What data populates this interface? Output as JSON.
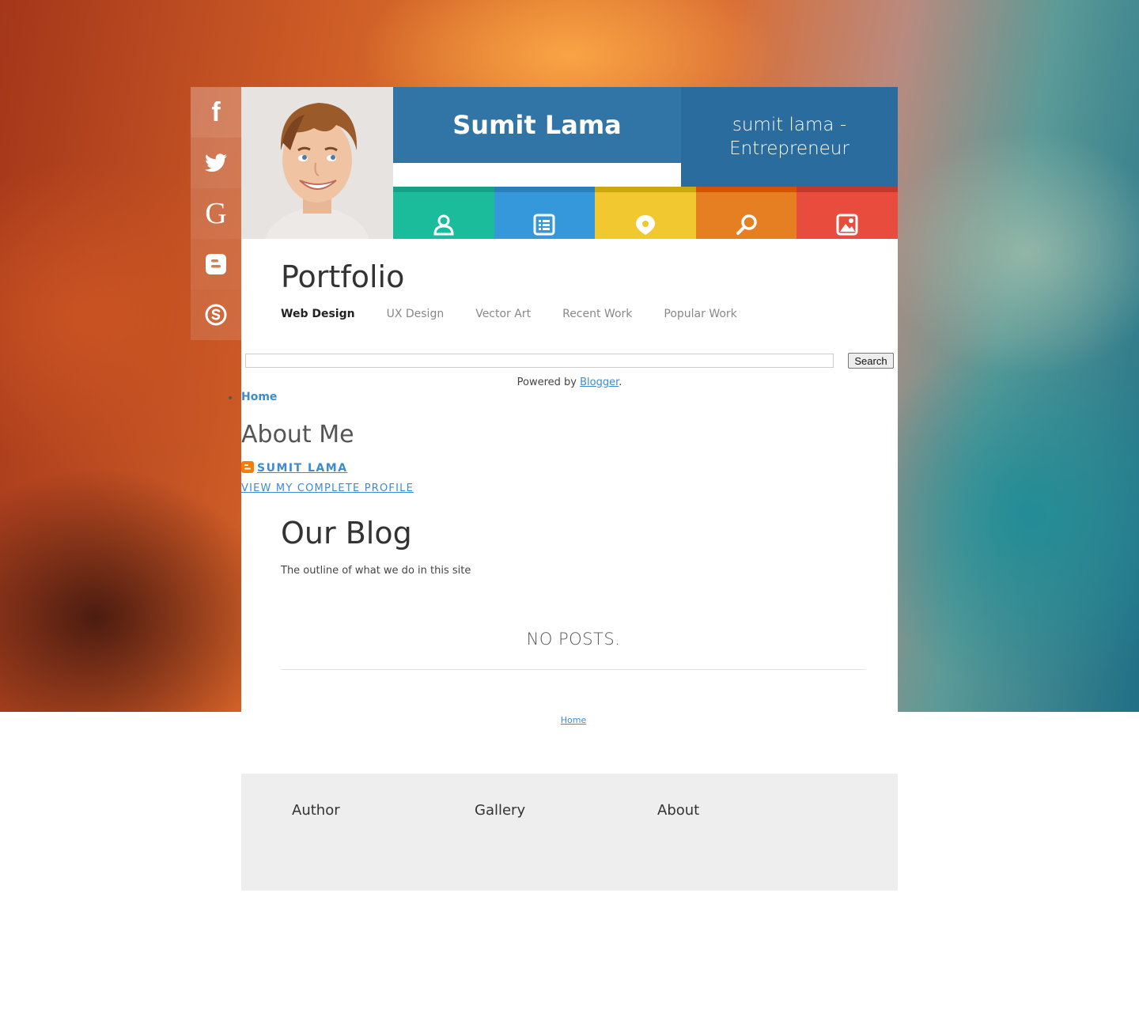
{
  "social": {
    "items": [
      {
        "name": "facebook",
        "glyph": "f"
      },
      {
        "name": "twitter",
        "glyph": ""
      },
      {
        "name": "google",
        "glyph": "G"
      },
      {
        "name": "blogger",
        "glyph": ""
      },
      {
        "name": "skype",
        "glyph": ""
      }
    ]
  },
  "header": {
    "title": "Sumit Lama",
    "description": "sumit lama - Entrepreneur"
  },
  "tiles": [
    {
      "icon": "user-icon",
      "color": "#1abc9c"
    },
    {
      "icon": "list-icon",
      "color": "#3498db"
    },
    {
      "icon": "location-icon",
      "color": "#f1c82f"
    },
    {
      "icon": "search-icon",
      "color": "#e67e22"
    },
    {
      "icon": "image-icon",
      "color": "#e74c3c"
    }
  ],
  "portfolio": {
    "title": "Portfolio",
    "nav": [
      "Web Design",
      "UX Design",
      "Vector Art",
      "Recent Work",
      "Popular Work"
    ]
  },
  "search": {
    "button_label": "Search",
    "value": ""
  },
  "powered": {
    "prefix": "Powered by ",
    "link": "Blogger",
    "suffix": "."
  },
  "pages": {
    "home": "Home"
  },
  "about": {
    "title": "About Me",
    "name": "SUMIT LAMA",
    "profile_link": "VIEW MY COMPLETE PROFILE"
  },
  "blog": {
    "title": "Our Blog",
    "subtitle": "The outline of what we do in this site",
    "no_posts": "NO POSTS."
  },
  "footer": {
    "home_link": "Home",
    "columns": [
      "Author",
      "Gallery",
      "About"
    ]
  }
}
